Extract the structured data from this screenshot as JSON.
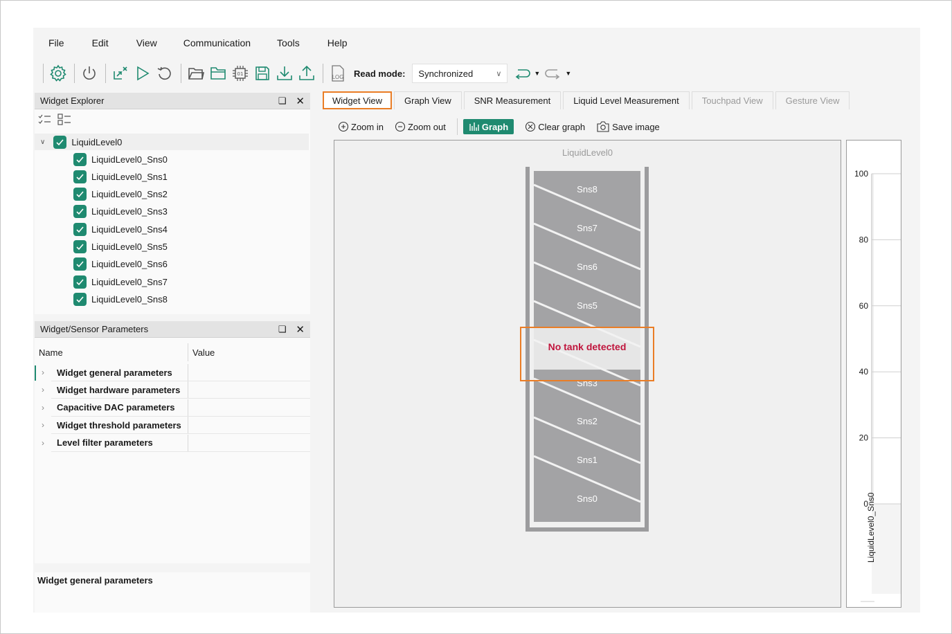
{
  "menu": [
    "File",
    "Edit",
    "View",
    "Communication",
    "Tools",
    "Help"
  ],
  "toolbar": {
    "icons": [
      "gear-icon",
      "power-icon",
      "disconnect-icon",
      "play-icon",
      "restart-icon",
      "open-folder-icon",
      "folder-icon",
      "chip-icon",
      "save-icon",
      "download-icon",
      "upload-icon",
      "log-icon"
    ],
    "log_text": "LOG",
    "chip_text": "01",
    "read_mode_label": "Read mode:",
    "read_mode_value": "Synchronized",
    "undo_icon": "undo-icon",
    "redo_icon": "redo-icon"
  },
  "explorer": {
    "title": "Widget Explorer",
    "root": "LiquidLevel0",
    "sensors": [
      "LiquidLevel0_Sns0",
      "LiquidLevel0_Sns1",
      "LiquidLevel0_Sns2",
      "LiquidLevel0_Sns3",
      "LiquidLevel0_Sns4",
      "LiquidLevel0_Sns5",
      "LiquidLevel0_Sns6",
      "LiquidLevel0_Sns7",
      "LiquidLevel0_Sns8"
    ]
  },
  "params": {
    "title": "Widget/Sensor Parameters",
    "col_name": "Name",
    "col_value": "Value",
    "rows": [
      "Widget general parameters",
      "Widget hardware parameters",
      "Capacitive DAC parameters",
      "Widget threshold parameters",
      "Level filter parameters"
    ]
  },
  "description": "Widget general parameters",
  "tabs": [
    {
      "label": "Widget View",
      "state": "active"
    },
    {
      "label": "Graph View",
      "state": "normal"
    },
    {
      "label": "SNR Measurement",
      "state": "normal"
    },
    {
      "label": "Liquid Level Measurement",
      "state": "normal"
    },
    {
      "label": "Touchpad View",
      "state": "disabled"
    },
    {
      "label": "Gesture View",
      "state": "disabled"
    }
  ],
  "view_toolbar": {
    "zoom_in": "Zoom in",
    "zoom_out": "Zoom out",
    "graph": "Graph",
    "clear_graph": "Clear graph",
    "save_image": "Save image"
  },
  "canvas": {
    "title": "LiquidLevel0",
    "top_sensors": [
      "Sns8",
      "Sns7",
      "Sns6",
      "Sns5"
    ],
    "bottom_sensors": [
      "Sns3",
      "Sns2",
      "Sns1",
      "Sns0"
    ],
    "alert": "No tank detected"
  },
  "level_graph": {
    "ticks": [
      "100",
      "80",
      "60",
      "40",
      "20",
      "0"
    ],
    "series": "LiquidLevel0_Sns0"
  },
  "colors": {
    "accent": "#1f8a70",
    "highlight": "#ea7d25",
    "alert": "#c0143c",
    "sensor": "#a3a3a5"
  }
}
